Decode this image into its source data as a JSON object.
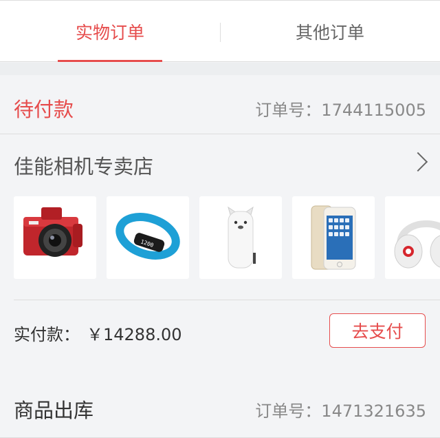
{
  "tabs": [
    {
      "label": "实物订单",
      "active": true
    },
    {
      "label": "其他订单",
      "active": false
    }
  ],
  "colors": {
    "accent": "#e64c4c",
    "muted": "#888888",
    "bg": "#f3f4f6"
  },
  "order1": {
    "status": "待付款",
    "order_no": "订单号：1744115005",
    "store": "佳能相机专卖店",
    "products": [
      {
        "icon": "camera-icon"
      },
      {
        "icon": "fitness-band-icon"
      },
      {
        "icon": "power-bank-icon"
      },
      {
        "icon": "smartphone-icon"
      },
      {
        "icon": "headphones-icon"
      }
    ],
    "band_screen_text": "1200",
    "paid_label": "实付款：",
    "paid_amount": "￥14288.00",
    "pay_button": "去支付"
  },
  "order2": {
    "status": "商品出库",
    "order_no": "订单号：1471321635"
  }
}
